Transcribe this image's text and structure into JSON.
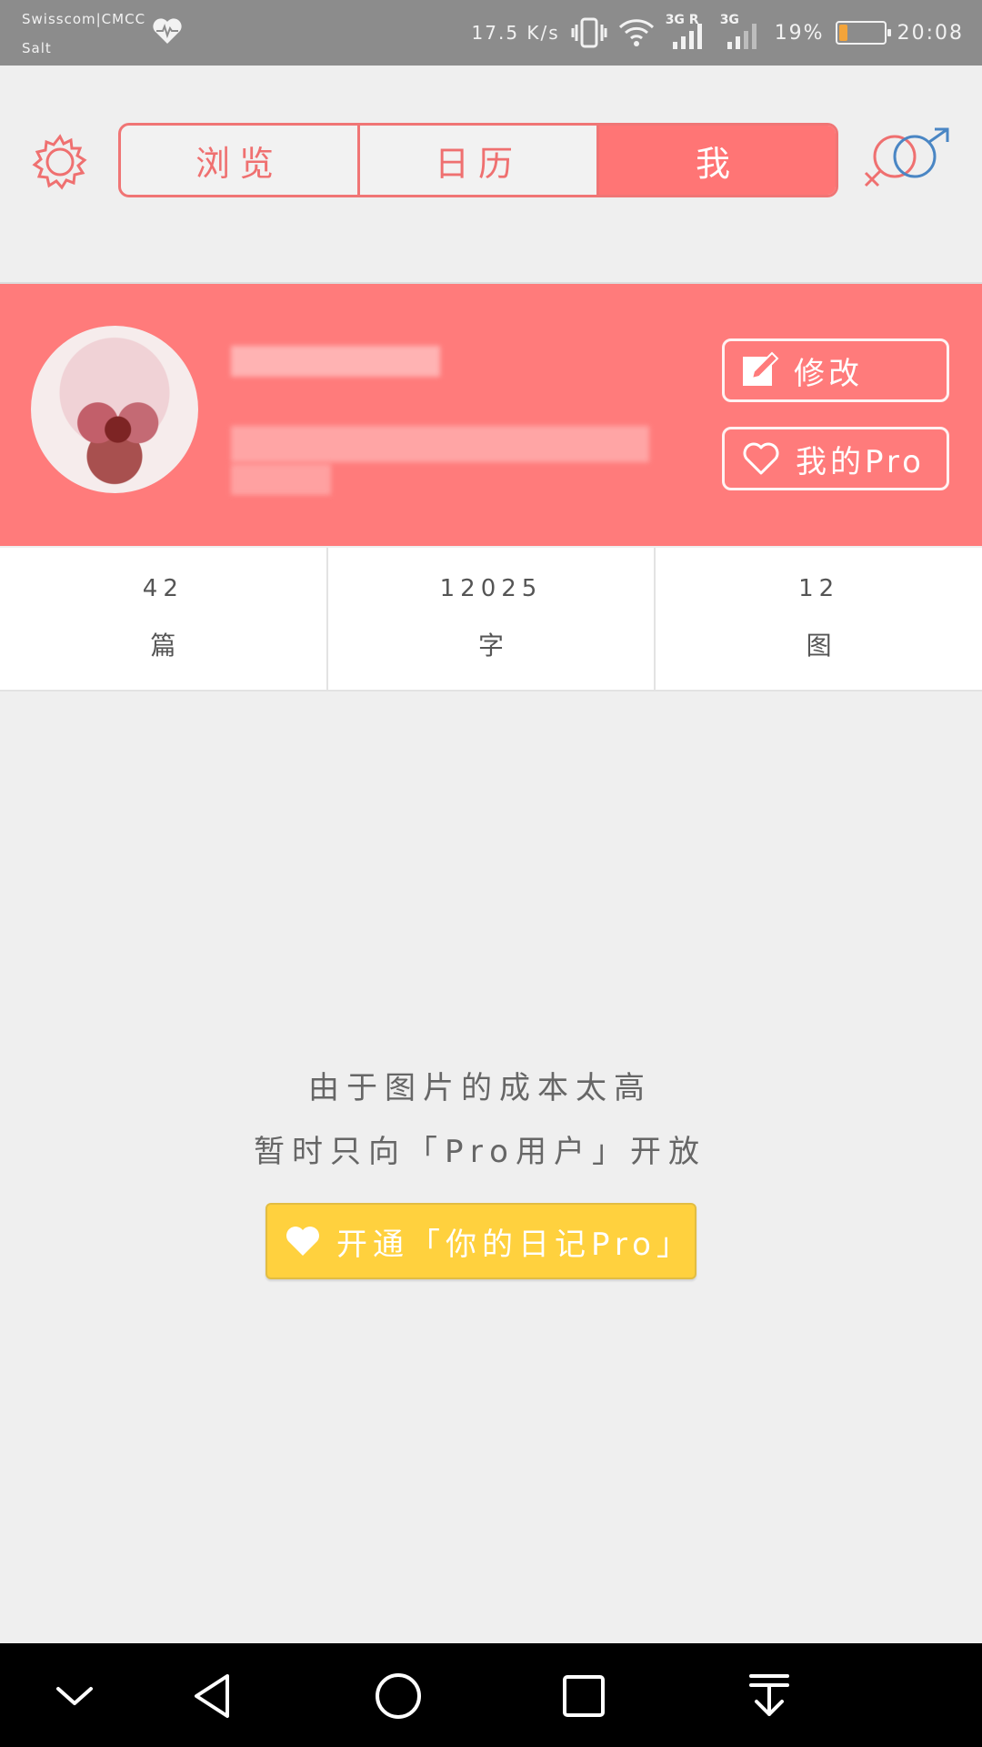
{
  "status_bar": {
    "carrier_line1": "Swisscom|CMCC",
    "carrier_line2": "Salt",
    "net_speed": "17.5 K/s",
    "signal1_label": "3G R",
    "signal2_label": "3G",
    "battery_percent": "19%",
    "battery_level": 0.19,
    "time": "20:08",
    "icons": [
      "heartbeat-icon",
      "vibrate-icon",
      "wifi-icon",
      "signal-icon",
      "signal-icon",
      "battery-icon"
    ]
  },
  "header": {
    "settings_icon": "gear-icon",
    "gender_icon": "gender-symbol-icon",
    "tabs": [
      {
        "label": "浏览",
        "active": false
      },
      {
        "label": "日历",
        "active": false
      },
      {
        "label": "我",
        "active": true
      }
    ]
  },
  "profile": {
    "edit_label": "修改",
    "pro_label": "我的Pro",
    "edit_icon": "edit-icon",
    "pro_icon": "heart-outline-icon"
  },
  "stats": [
    {
      "value": "42",
      "label": "篇"
    },
    {
      "value": "12025",
      "label": "字"
    },
    {
      "value": "12",
      "label": "图"
    }
  ],
  "notice": {
    "line1": "由于图片的成本太高",
    "line2": "暂时只向「Pro用户」开放",
    "button_label": "开通「你的日记Pro」",
    "button_icon": "heart-icon"
  },
  "nav_bar": {
    "icons": [
      "chevron-down-icon",
      "back-icon",
      "home-icon",
      "recents-icon",
      "download-icon"
    ]
  },
  "colors": {
    "accent": "#ff7b7b",
    "tab_border": "#f07575",
    "pro_button": "#ffd13e",
    "status_bar": "#8c8c8c"
  }
}
